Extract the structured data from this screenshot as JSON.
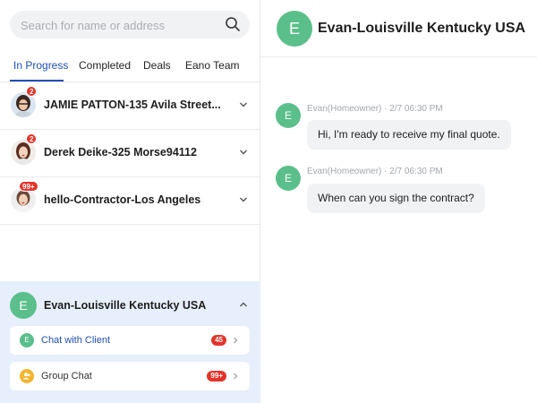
{
  "search": {
    "placeholder": "Search for name or address",
    "icon": "search-icon"
  },
  "tabs": [
    {
      "label": "In Progress",
      "active": true
    },
    {
      "label": "Completed",
      "active": false
    },
    {
      "label": "Deals",
      "active": false
    },
    {
      "label": "Eano Team",
      "active": false
    }
  ],
  "conversations": [
    {
      "name": "JAMIE PATTON-135 Avila Street...",
      "badge": "2"
    },
    {
      "name": "Derek Deike-325 Morse94112",
      "badge": "2"
    },
    {
      "name": "hello-Contractor-Los Angeles",
      "badge": "99+"
    }
  ],
  "active_conversation": {
    "initial": "E",
    "title": "Evan-Louisville Kentucky USA",
    "subitems": [
      {
        "label": "Chat with Client",
        "badge": "45",
        "icon_initial": "E",
        "icon_color": "#5bbf8b",
        "label_color": "#1f4fb7"
      },
      {
        "label": "Group Chat",
        "badge": "99+",
        "icon_color": "#f3b531",
        "label_color": "#333333"
      }
    ]
  },
  "chat": {
    "initial": "E",
    "title": "Evan-Louisville Kentucky USA",
    "messages": [
      {
        "initial": "E",
        "meta": "Evan(Homeowner) · 2/7 06:30 PM",
        "text": "Hi, I'm ready to receive my final quote."
      },
      {
        "initial": "E",
        "meta": "Evan(Homeowner) · 2/7 06:30 PM",
        "text": "When can you sign the contract?"
      }
    ]
  },
  "colors": {
    "accent": "#1f4fb7",
    "avatar_green": "#5bbf8b",
    "badge_red": "#e5332a",
    "panel_bg": "#e6effb"
  }
}
